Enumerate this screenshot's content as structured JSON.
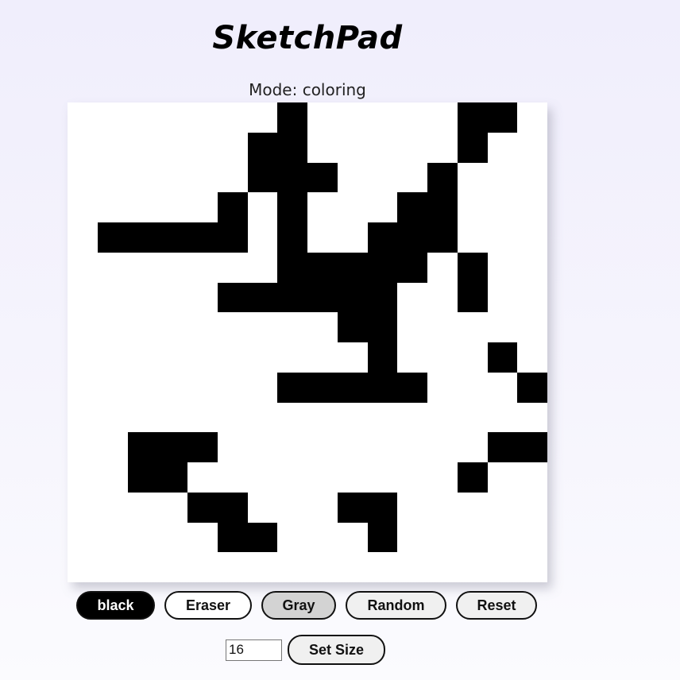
{
  "app": {
    "title": "SketchPad",
    "mode_text": "Mode: coloring"
  },
  "grid": {
    "size": 16,
    "rows": [
      "0000000100000110",
      "0000001100000100",
      "0000001110001000",
      "0000010100011000",
      "0111110100111000",
      "0000000111110100",
      "0000011111100100",
      "0000000001100000",
      "0000000000100010",
      "0000000111110001",
      "0000000000000000",
      "0011100000000011",
      "0011000000000100",
      "0000110001100000",
      "0000011000100000",
      "0000000000000000"
    ]
  },
  "buttons": {
    "black": "black",
    "eraser": "Eraser",
    "gray": "Gray",
    "random": "Random",
    "reset": "Reset",
    "set_size": "Set Size"
  },
  "size_input": {
    "value": "16"
  },
  "colors": {
    "paint": "#000000",
    "background": "#ffffff",
    "gray_button": "#d3d3d3"
  }
}
